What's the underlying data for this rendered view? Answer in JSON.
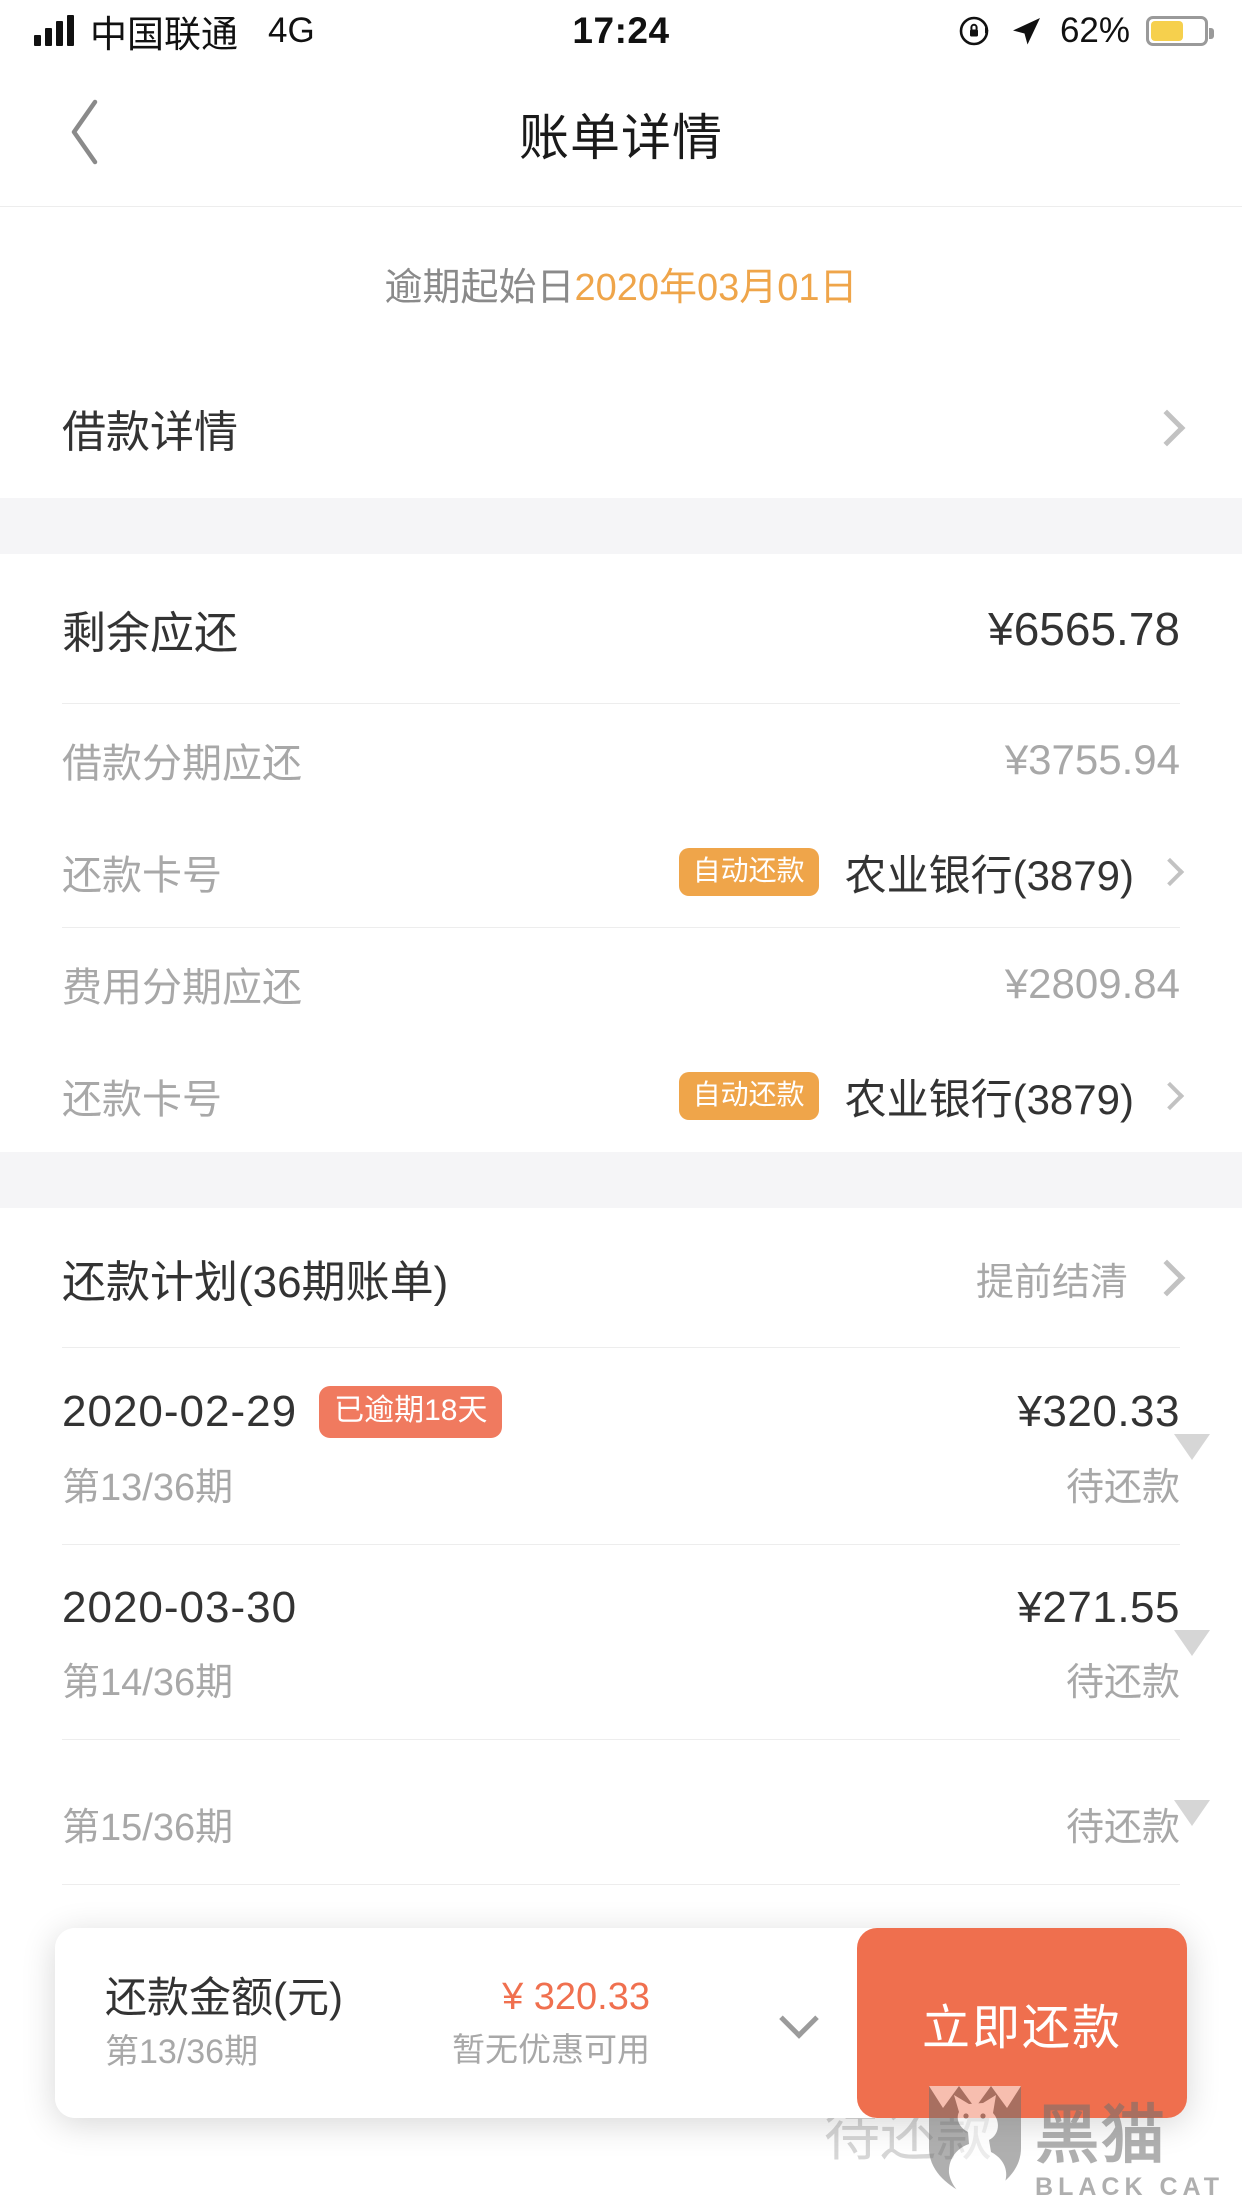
{
  "status_bar": {
    "carrier": "中国联通",
    "network": "4G",
    "time": "17:24",
    "battery_percent": "62%",
    "battery_level": 62,
    "signal_bars": 4,
    "icons": [
      "signal-bars-icon",
      "rotation-lock-icon",
      "location-arrow-icon",
      "battery-icon"
    ]
  },
  "nav": {
    "back_icon": "chevron-left-icon",
    "title": "账单详情"
  },
  "overdue_banner": {
    "label": "逾期起始日",
    "date": "2020年03月01日",
    "date_color": "#efa54a"
  },
  "loan_detail_row": {
    "label": "借款详情",
    "chevron": "chevron-right-icon"
  },
  "summary": {
    "remaining_label": "剩余应还",
    "remaining_value": "¥6565.78",
    "groups": [
      {
        "amount_label": "借款分期应还",
        "amount_value": "¥3755.94",
        "card_label": "还款卡号",
        "auto_badge": "自动还款",
        "card_value": "农业银行(3879)",
        "chevron": "chevron-right-icon"
      },
      {
        "amount_label": "费用分期应还",
        "amount_value": "¥2809.84",
        "card_label": "还款卡号",
        "auto_badge": "自动还款",
        "card_value": "农业银行(3879)",
        "chevron": "chevron-right-icon"
      }
    ]
  },
  "plan": {
    "title": "还款计划(36期账单)",
    "action": "提前结清",
    "chevron": "chevron-right-icon",
    "items": [
      {
        "date": "2020-02-29",
        "overdue_badge": "已逾期18天",
        "amount": "¥320.33",
        "term": "第13/36期",
        "status": "待还款",
        "expander": "triangle-down-icon"
      },
      {
        "date": "2020-03-30",
        "overdue_badge": "",
        "amount": "¥271.55",
        "term": "第14/36期",
        "status": "待还款",
        "expander": "triangle-down-icon"
      },
      {
        "date": "",
        "overdue_badge": "",
        "amount": "",
        "term": "第15/36期",
        "status": "待还款",
        "expander": "triangle-down-icon"
      }
    ]
  },
  "bottom_bar": {
    "title": "还款金额(元)",
    "subtitle": "第13/36期",
    "amount": "¥ 320.33",
    "promo": "暂无优惠可用",
    "expand_icon": "chevron-down-icon",
    "button_label": "立即还款",
    "button_color": "#ef6f4e",
    "amount_color": "#f0704f"
  },
  "watermark": {
    "cn": "黑猫",
    "en": "BLACK CAT",
    "shield": "cat-shield-icon"
  },
  "colors": {
    "accent_orange": "#efa54a",
    "accent_coral": "#f07a5f",
    "button": "#ef6f4e",
    "band": "#f5f5f7",
    "text_primary": "#333333",
    "text_muted": "#a8a8a8"
  }
}
